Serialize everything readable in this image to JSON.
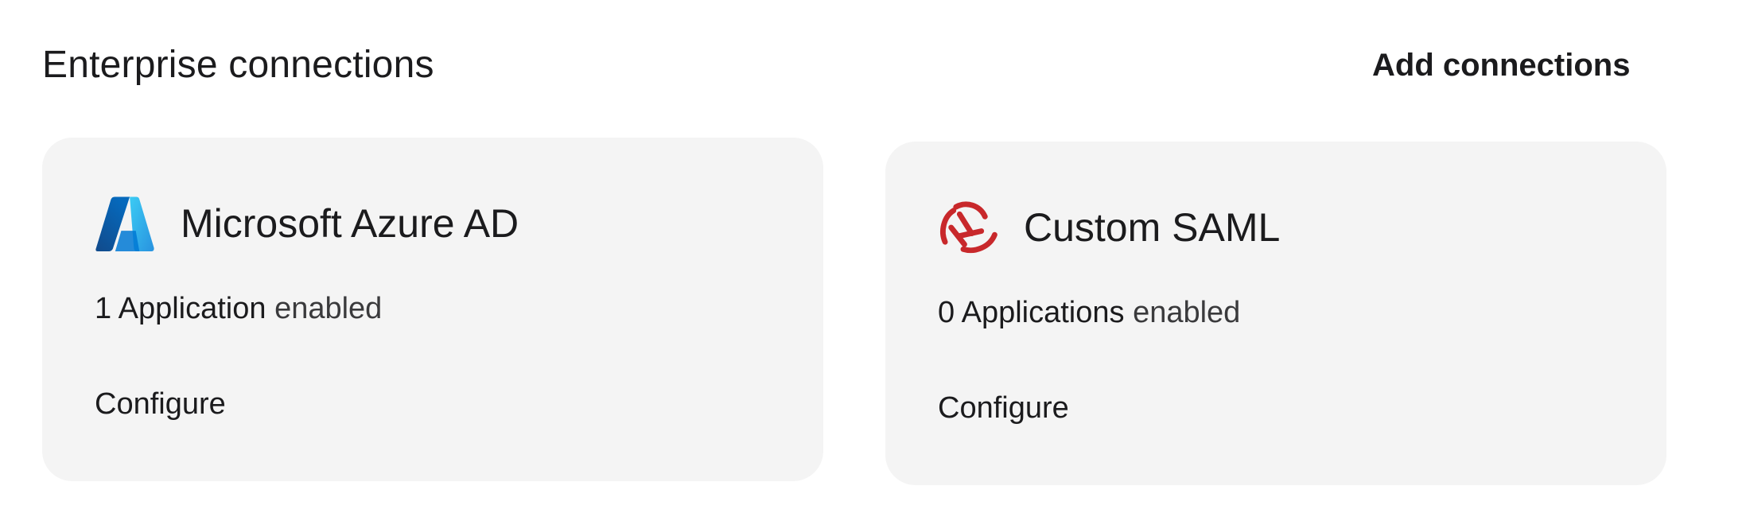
{
  "section": {
    "title": "Enterprise connections",
    "add_button_label": "Add connections"
  },
  "connections": [
    {
      "name": "Microsoft Azure AD",
      "icon": "azure-ad-logo",
      "apps_count_text": "1 Application",
      "apps_suffix_text": "enabled",
      "configure_label": "Configure"
    },
    {
      "name": "Custom SAML",
      "icon": "saml-logo",
      "apps_count_text": "0 Applications",
      "apps_suffix_text": "enabled",
      "configure_label": "Configure"
    }
  ],
  "colors": {
    "card_background": "#f4f4f4",
    "azure_blue": "#0a6cd4",
    "saml_red": "#c8282b"
  }
}
